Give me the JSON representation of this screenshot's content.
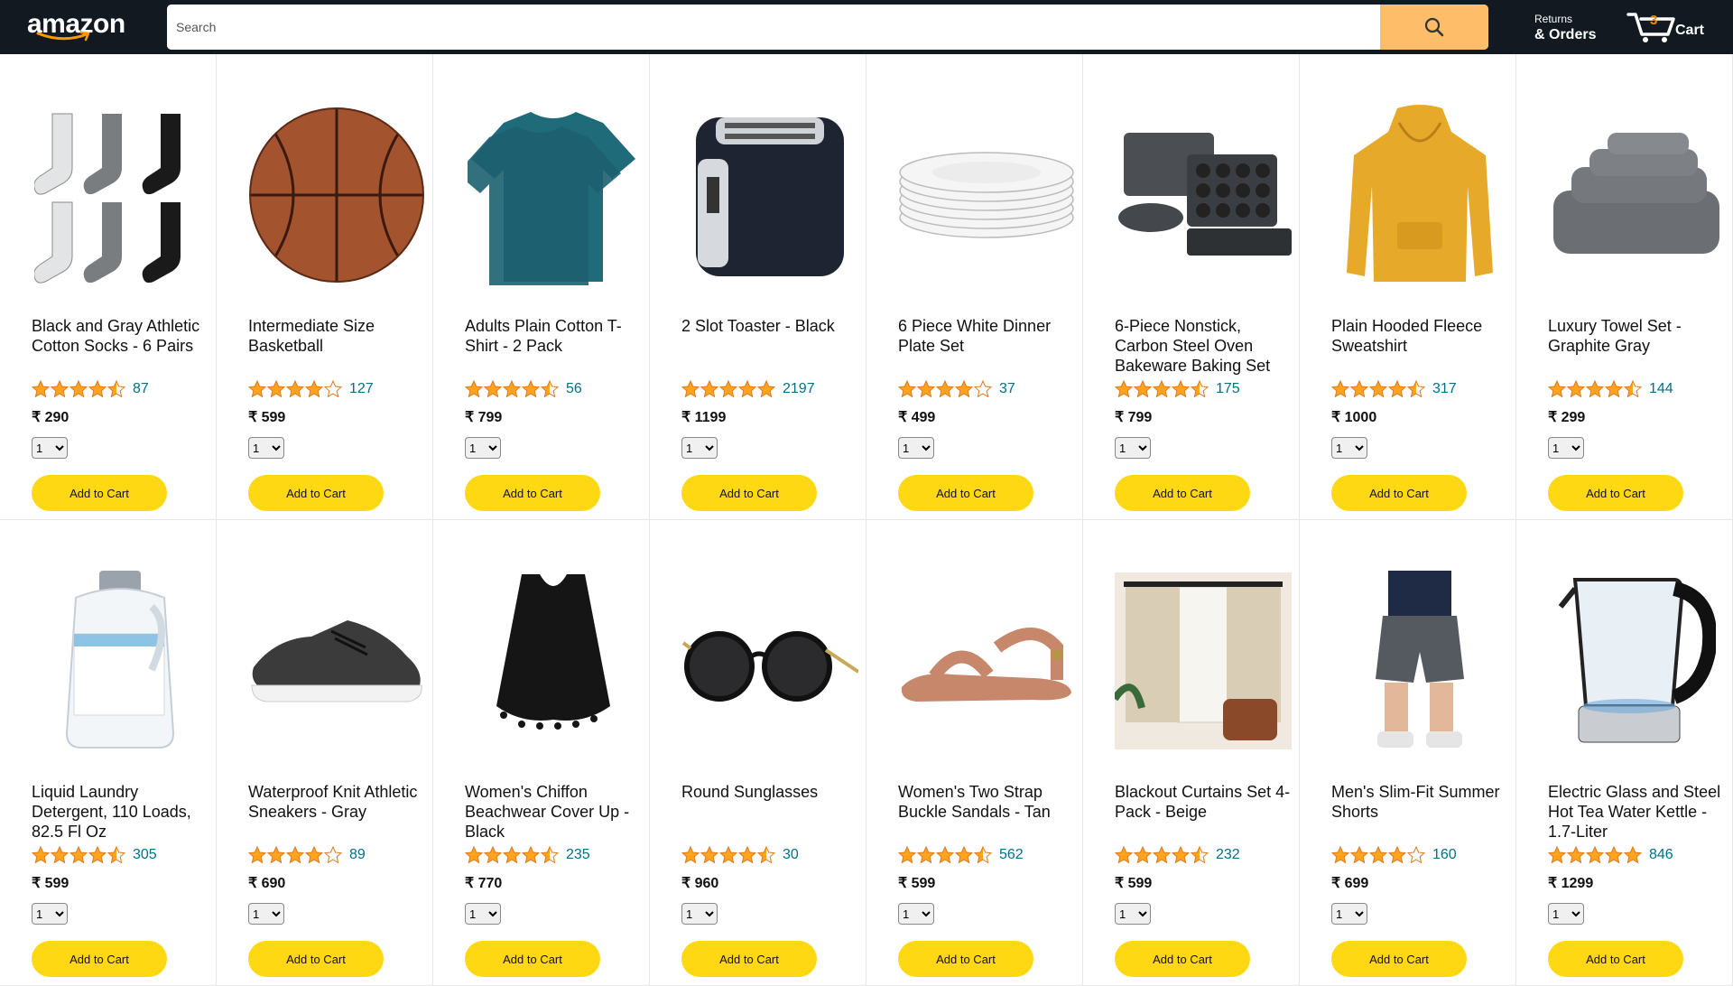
{
  "header": {
    "logo_text": "amazon",
    "search_placeholder": "Search",
    "returns_top": "Returns",
    "returns_bottom": "& Orders",
    "cart_count": "3",
    "cart_label": "Cart"
  },
  "colors": {
    "header_bg": "#131921",
    "search_button": "#febd69",
    "add_button": "#ffd814",
    "star": "#ffa41c",
    "link": "#007185",
    "cart_count": "#f08804"
  },
  "products": [
    {
      "title": "Black and Gray Athletic Cotton Socks - 6 Pairs",
      "rating": 4.5,
      "reviews": "87",
      "price": "₹ 290",
      "qty": "1",
      "button": "Add to Cart",
      "icon": "socks-icon"
    },
    {
      "title": "Intermediate Size Basketball",
      "rating": 4,
      "reviews": "127",
      "price": "₹ 599",
      "qty": "1",
      "button": "Add to Cart",
      "icon": "basketball-icon"
    },
    {
      "title": "Adults Plain Cotton T-Shirt - 2 Pack",
      "rating": 4.5,
      "reviews": "56",
      "price": "₹ 799",
      "qty": "1",
      "button": "Add to Cart",
      "icon": "tshirt-icon"
    },
    {
      "title": "2 Slot Toaster - Black",
      "rating": 5,
      "reviews": "2197",
      "price": "₹ 1199",
      "qty": "1",
      "button": "Add to Cart",
      "icon": "toaster-icon"
    },
    {
      "title": "6 Piece White Dinner Plate Set",
      "rating": 4,
      "reviews": "37",
      "price": "₹ 499",
      "qty": "1",
      "button": "Add to Cart",
      "icon": "plates-icon"
    },
    {
      "title": "6-Piece Nonstick, Carbon Steel Oven Bakeware Baking Set",
      "rating": 4.5,
      "reviews": "175",
      "price": "₹ 799",
      "qty": "1",
      "button": "Add to Cart",
      "icon": "bakeware-icon"
    },
    {
      "title": "Plain Hooded Fleece Sweatshirt",
      "rating": 4.5,
      "reviews": "317",
      "price": "₹ 1000",
      "qty": "1",
      "button": "Add to Cart",
      "icon": "hoodie-icon"
    },
    {
      "title": "Luxury Towel Set - Graphite Gray",
      "rating": 4.5,
      "reviews": "144",
      "price": "₹ 299",
      "qty": "1",
      "button": "Add to Cart",
      "icon": "towels-icon"
    },
    {
      "title": "Liquid Laundry Detergent, 110 Loads, 82.5 Fl Oz",
      "rating": 4.5,
      "reviews": "305",
      "price": "₹ 599",
      "qty": "1",
      "button": "Add to Cart",
      "icon": "detergent-icon"
    },
    {
      "title": "Waterproof Knit Athletic Sneakers - Gray",
      "rating": 4,
      "reviews": "89",
      "price": "₹ 690",
      "qty": "1",
      "button": "Add to Cart",
      "icon": "sneaker-icon"
    },
    {
      "title": "Women's Chiffon Beachwear Cover Up - Black",
      "rating": 4.5,
      "reviews": "235",
      "price": "₹ 770",
      "qty": "1",
      "button": "Add to Cart",
      "icon": "coverup-icon"
    },
    {
      "title": "Round Sunglasses",
      "rating": 4.5,
      "reviews": "30",
      "price": "₹ 960",
      "qty": "1",
      "button": "Add to Cart",
      "icon": "sunglasses-icon"
    },
    {
      "title": "Women's Two Strap Buckle Sandals - Tan",
      "rating": 4.5,
      "reviews": "562",
      "price": "₹ 599",
      "qty": "1",
      "button": "Add to Cart",
      "icon": "sandal-icon"
    },
    {
      "title": "Blackout Curtains Set 4-Pack - Beige",
      "rating": 4.5,
      "reviews": "232",
      "price": "₹ 599",
      "qty": "1",
      "button": "Add to Cart",
      "icon": "curtains-icon"
    },
    {
      "title": "Men's Slim-Fit Summer Shorts",
      "rating": 4,
      "reviews": "160",
      "price": "₹ 699",
      "qty": "1",
      "button": "Add to Cart",
      "icon": "shorts-icon"
    },
    {
      "title": "Electric Glass and Steel Hot Tea Water Kettle - 1.7-Liter",
      "rating": 5,
      "reviews": "846",
      "price": "₹ 1299",
      "qty": "1",
      "button": "Add to Cart",
      "icon": "kettle-icon"
    }
  ]
}
